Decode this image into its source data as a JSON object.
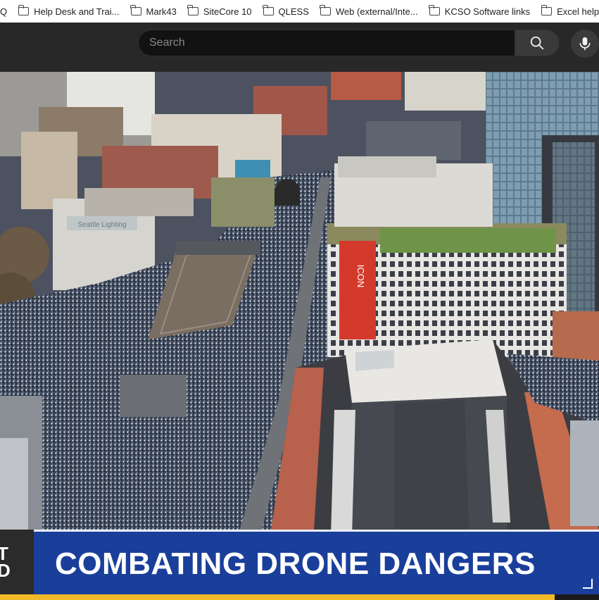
{
  "bookmarks": [
    {
      "label": "Q"
    },
    {
      "label": "Help Desk and Trai..."
    },
    {
      "label": "Mark43"
    },
    {
      "label": "SiteCore 10"
    },
    {
      "label": "QLESS"
    },
    {
      "label": "Web (external/Inte..."
    },
    {
      "label": "KCSO Software links"
    },
    {
      "label": "Excel help site"
    }
  ],
  "search": {
    "placeholder": "Search",
    "value": ""
  },
  "video": {
    "building_sign": "Seattle Lighting",
    "vertical_sign": "ICON",
    "lower_third": {
      "logo_text": "T\nD",
      "headline": "COMBATING DRONE DANGERS"
    }
  },
  "colors": {
    "banner_blue": "#1a3f9a",
    "stripe_yellow": "#f2b928",
    "topbar": "#282828"
  }
}
